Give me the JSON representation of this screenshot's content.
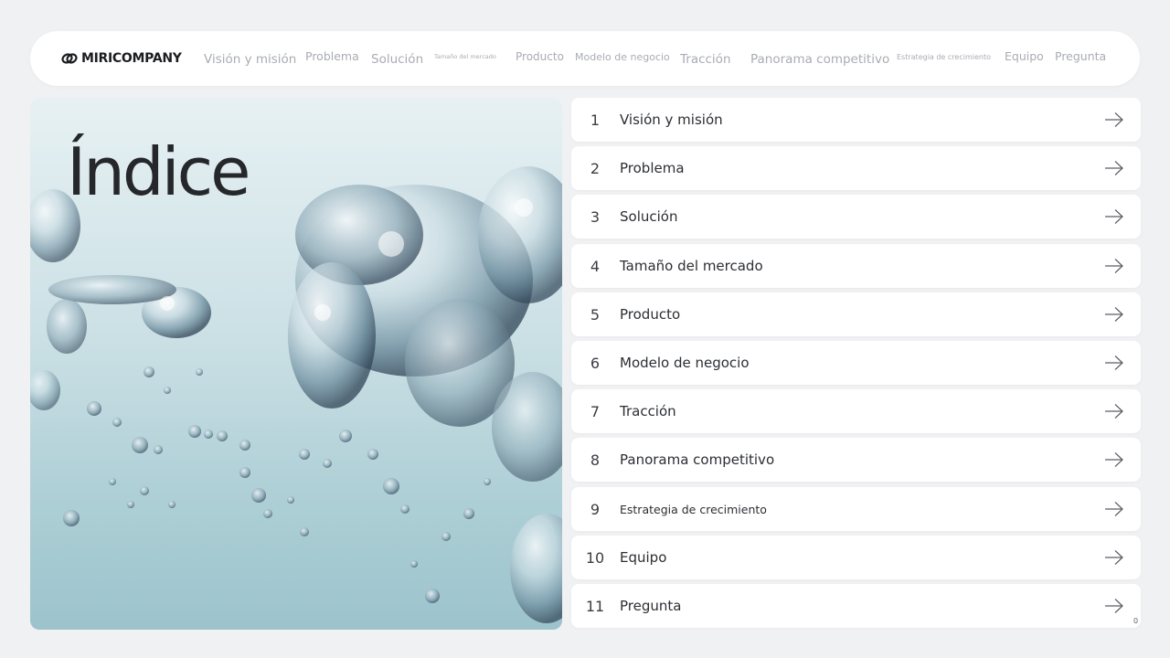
{
  "brand": {
    "name": "MIRICOMPANY",
    "icon": "link-logo-icon"
  },
  "nav": {
    "items": [
      {
        "label": "Visión y misión"
      },
      {
        "label": "Problema"
      },
      {
        "label": "Solución"
      },
      {
        "label": "Tamaño del mercado"
      },
      {
        "label": "Producto"
      },
      {
        "label": "Modelo de negocio"
      },
      {
        "label": "Tracción"
      },
      {
        "label": "Panorama competitivo"
      },
      {
        "label": "Estrategia de crecimiento"
      },
      {
        "label": "Equipo"
      },
      {
        "label": "Pregunta"
      }
    ]
  },
  "hero": {
    "title": "Índice",
    "image": "water-bubbles-photo"
  },
  "toc": {
    "arrow_icon": "arrow-right-icon",
    "items": [
      {
        "number": "1",
        "label": "Visión y misión"
      },
      {
        "number": "2",
        "label": "Problema"
      },
      {
        "number": "3",
        "label": "Solución"
      },
      {
        "number": "4",
        "label": "Tamaño del mercado"
      },
      {
        "number": "5",
        "label": "Producto"
      },
      {
        "number": "6",
        "label": "Modelo de negocio"
      },
      {
        "number": "7",
        "label": "Tracción"
      },
      {
        "number": "8",
        "label": "Panorama competitivo"
      },
      {
        "number": "9",
        "label": "Estrategia de crecimiento"
      },
      {
        "number": "10",
        "label": "Equipo"
      },
      {
        "number": "11",
        "label": "Pregunta"
      }
    ]
  },
  "page_number": "0",
  "colors": {
    "background": "#f0f1f3",
    "card": "#ffffff",
    "nav_text": "#a9acb3",
    "title_text": "#25272b"
  }
}
